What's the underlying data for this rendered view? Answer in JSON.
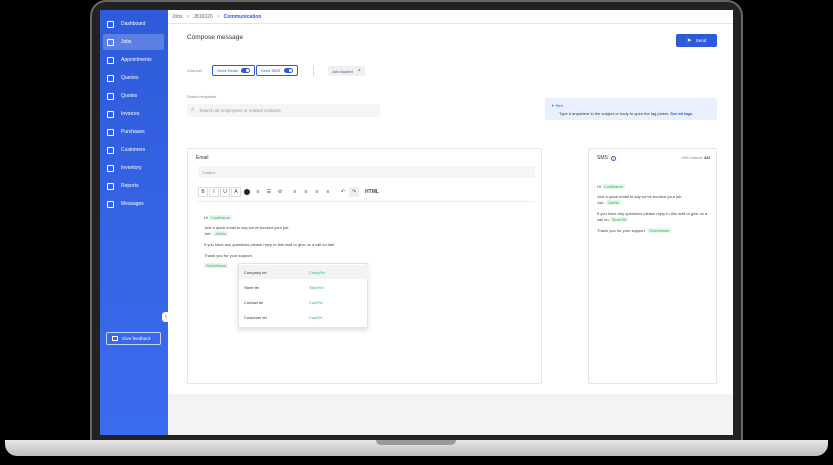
{
  "sidebar": {
    "items": [
      {
        "label": "Dashboard"
      },
      {
        "label": "Jobs"
      },
      {
        "label": "Appointments"
      },
      {
        "label": "Queries"
      },
      {
        "label": "Quotes"
      },
      {
        "label": "Invoices"
      },
      {
        "label": "Purchases"
      },
      {
        "label": "Customers"
      },
      {
        "label": "Inventory"
      },
      {
        "label": "Reports"
      },
      {
        "label": "Messages"
      }
    ],
    "collapse": "‹",
    "feedback": "Give feedback"
  },
  "breadcrumb": {
    "jobs": "Jobs",
    "job": "J810020",
    "current": "Communication",
    "sep": ">"
  },
  "page": {
    "title": "Compose message",
    "send": "Send"
  },
  "channel": {
    "label": "Channel",
    "email": "Send Email",
    "sms": "Send SMS",
    "chip": "Job booked"
  },
  "recipients": {
    "label": "Select recipients",
    "placeholder": "Search all employees or related contacts"
  },
  "alert": {
    "title": "Hint",
    "text": "Type # anywhere in the subject or body to open the tag picker.",
    "link": "See all tags"
  },
  "email": {
    "title": "Email",
    "subject_placeholder": "Subject",
    "toolbar": [
      "B",
      "I",
      "U",
      "A",
      "",
      "≡",
      "☰",
      "⊘",
      "≡",
      "≡",
      "≡",
      "≡",
      "↶",
      "↷",
      "HTML"
    ],
    "hi": "Hi",
    "cust_tag": "CustName",
    "line1": "Just a quick email to say we've booked your job.",
    "job_label": "Job:",
    "job_tag": "JobNo",
    "line2": "If you have any questions please reply to this mail or give us a call on #tel",
    "line3": "Thank you for your support,",
    "store_tag": "StoreName"
  },
  "dropdown": [
    {
      "name": "Company tel",
      "tag": "CompTel"
    },
    {
      "name": "Store tel",
      "tag": "StoreTel"
    },
    {
      "name": "Contact tel",
      "tag": "ContTel"
    },
    {
      "name": "Customer tel",
      "tag": "CustTel"
    }
  ],
  "sms": {
    "title": "SMS",
    "info": "i",
    "balance_label": "SMS balance:",
    "balance": "324",
    "hi": "Hi",
    "cust_tag": "CustName",
    "line1": "Just a quick email to say we've booked your job.",
    "job_label": "Job:",
    "job_tag": "JobNo",
    "line2": "If you have any questions please reply to this mail or give us a call on",
    "tel_tag": "StoreTel",
    "line3": "Thank you for your support,",
    "store_tag": "StoreName"
  },
  "colors": {
    "accent": "#2e5bd9",
    "tag": "#2db35d"
  }
}
